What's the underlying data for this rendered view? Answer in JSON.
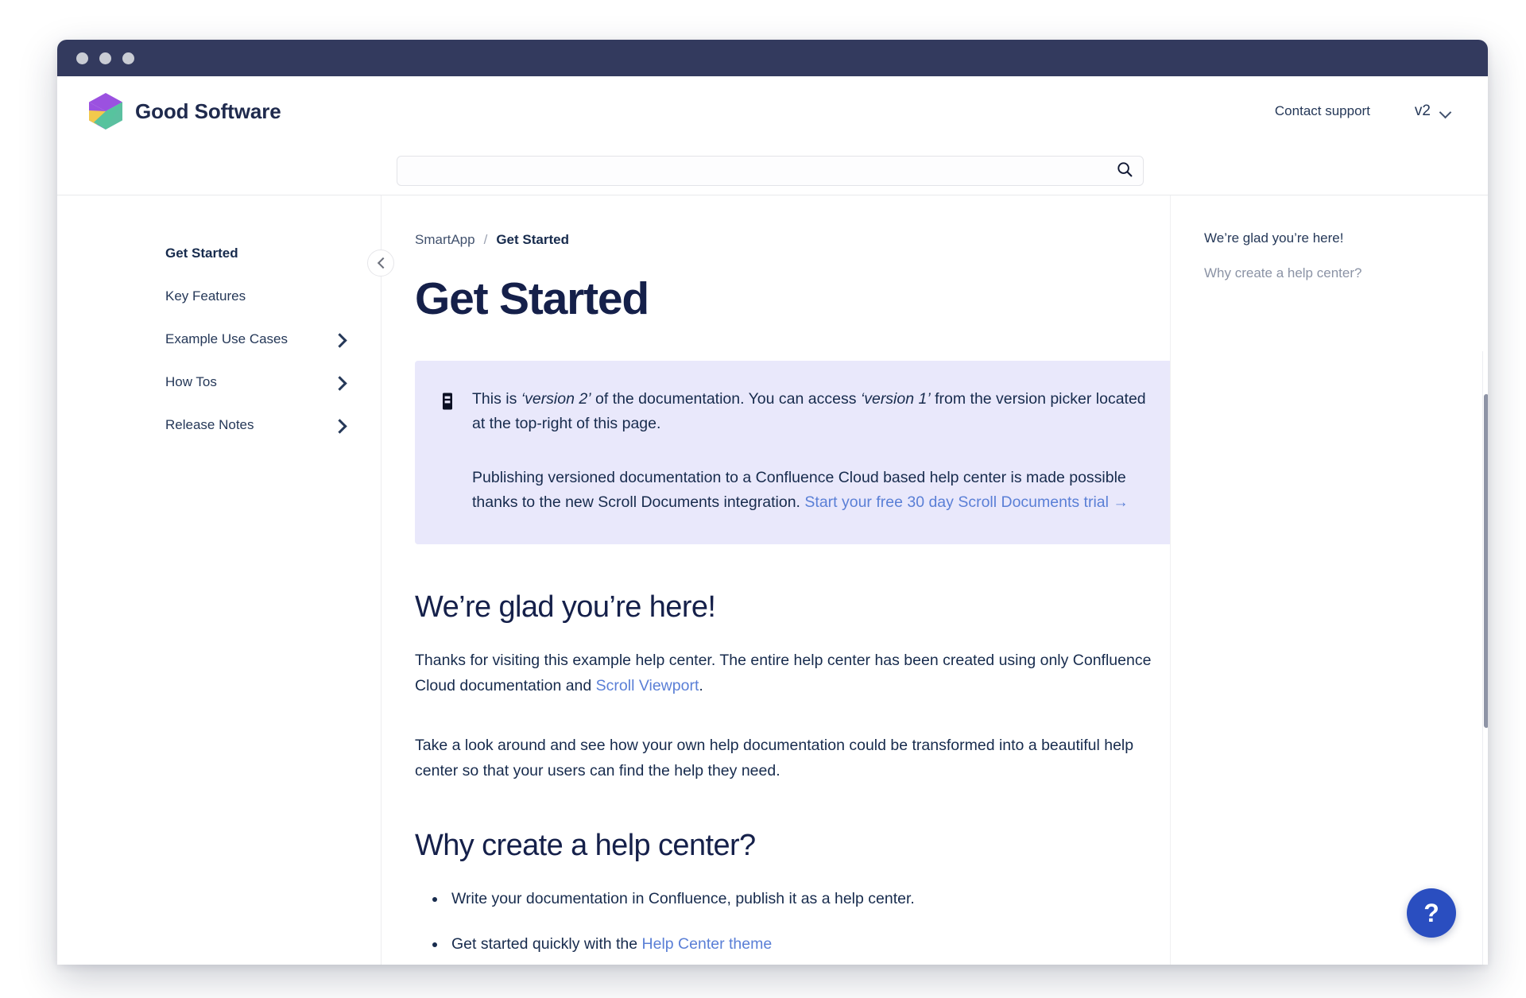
{
  "window": {
    "dots": [
      "close",
      "minimize",
      "maximize"
    ]
  },
  "header": {
    "brand_name": "Good Software",
    "logo_icon": "cube-logo-icon",
    "contact_support": "Contact support",
    "version_label": "v2",
    "version_chevron_icon": "chevron-down-icon"
  },
  "search": {
    "value": "",
    "placeholder": "",
    "icon": "search-icon"
  },
  "sidebar": {
    "collapse_icon": "chevron-left-icon",
    "items": [
      {
        "label": "Get Started",
        "active": true,
        "expandable": false
      },
      {
        "label": "Key Features",
        "active": false,
        "expandable": false
      },
      {
        "label": "Example Use Cases",
        "active": false,
        "expandable": true
      },
      {
        "label": "How Tos",
        "active": false,
        "expandable": true
      },
      {
        "label": "Release Notes",
        "active": false,
        "expandable": true
      }
    ]
  },
  "breadcrumb": {
    "root": "SmartApp",
    "separator": "/",
    "current": "Get Started"
  },
  "main": {
    "title": "Get Started",
    "callout": {
      "icon": "note-icon",
      "p1_a": "This is ",
      "p1_em1": "‘version 2’",
      "p1_b": " of the documentation. You can access ",
      "p1_em2": "‘version 1’",
      "p1_c": " from the version picker located at the top-right of this page.",
      "p2_a": "Publishing versioned documentation to a Confluence Cloud based help center is made possible thanks to the new Scroll Documents integration. ",
      "p2_link": "Start your free 30 day Scroll Documents trial →"
    },
    "section1": {
      "heading": "We’re glad you’re here!",
      "para1_a": "Thanks for visiting this example help center. The entire help center has been created using only Confluence Cloud documentation and ",
      "para1_link": "Scroll Viewport",
      "para1_b": ".",
      "para2": "Take a look around and see how your own help documentation could be transformed into a beautiful help center so that your users can find the help they need."
    },
    "section2": {
      "heading": "Why create a help center?",
      "bullet1": "Write your documentation in Confluence, publish it as a help center.",
      "bullet2_a": "Get started quickly with the ",
      "bullet2_link": "Help Center theme"
    }
  },
  "toc": {
    "items": [
      {
        "label": "We’re glad you’re here!",
        "active": true
      },
      {
        "label": "Why create a help center?",
        "active": false
      }
    ]
  },
  "help_fab": {
    "label": "?",
    "icon": "question-mark-icon"
  },
  "colors": {
    "titlebar": "#333a5e",
    "brand_text": "#1f2a4d",
    "callout_bg": "#e9e8fb",
    "link": "#5a7fd6",
    "fab": "#2a4ec0",
    "heading": "#15204a"
  }
}
